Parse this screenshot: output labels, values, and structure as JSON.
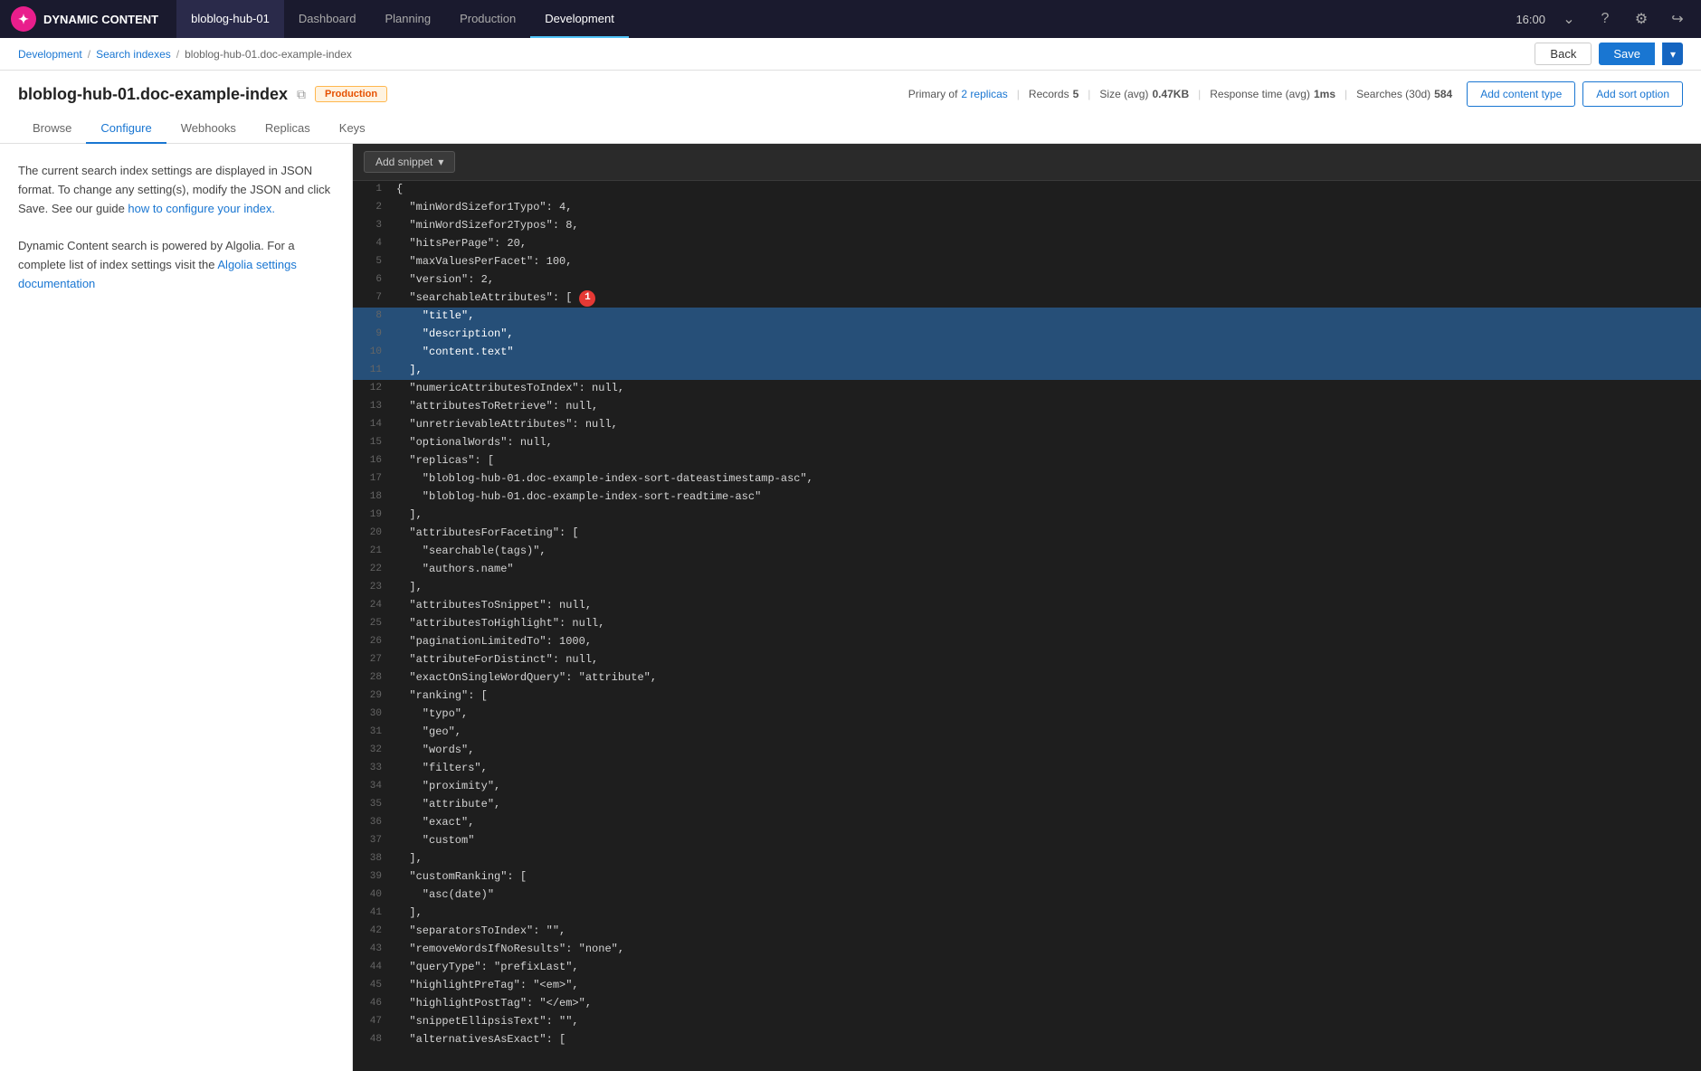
{
  "app": {
    "logo_text": "DYNAMIC CONTENT",
    "logo_icon": "✦"
  },
  "nav": {
    "current_app": "bloblog-hub-01",
    "tabs": [
      {
        "label": "Dashboard",
        "active": false
      },
      {
        "label": "Planning",
        "active": false
      },
      {
        "label": "Production",
        "active": false
      },
      {
        "label": "Development",
        "active": true
      }
    ],
    "time": "16:00"
  },
  "breadcrumb": {
    "items": [
      {
        "label": "Development",
        "href": "#"
      },
      {
        "label": "Search indexes",
        "href": "#"
      },
      {
        "label": "bloblog-hub-01.doc-example-index",
        "href": "#"
      }
    ],
    "back_label": "Back",
    "save_label": "Save"
  },
  "page": {
    "title": "bloblog-hub-01.doc-example-index",
    "env_badge": "Production",
    "meta": {
      "primary_of": "Primary of ",
      "replicas_count": "2 replicas",
      "records_label": "Records",
      "records_value": "5",
      "size_label": "Size (avg)",
      "size_value": "0.47KB",
      "response_label": "Response time (avg)",
      "response_value": "1ms",
      "searches_label": "Searches (30d)",
      "searches_value": "584"
    },
    "tabs": [
      {
        "label": "Browse",
        "active": false
      },
      {
        "label": "Configure",
        "active": true
      },
      {
        "label": "Webhooks",
        "active": false
      },
      {
        "label": "Replicas",
        "active": false
      },
      {
        "label": "Keys",
        "active": false
      }
    ],
    "add_content_type_label": "Add content type",
    "add_sort_option_label": "Add sort option"
  },
  "sidebar": {
    "para1": "The current search index settings are displayed in JSON format. To change any setting(s), modify the JSON and click Save. See our guide ",
    "para1_link_text": "how to configure your index.",
    "para2": "Dynamic Content search is powered by Algolia. For a complete list of index settings visit the ",
    "para2_link_text": "Algolia settings documentation"
  },
  "editor": {
    "snippet_button": "Add snippet",
    "lines": [
      {
        "num": 1,
        "content": "{",
        "selected": false
      },
      {
        "num": 2,
        "content": "  \"minWordSizefor1Typo\": 4,",
        "selected": false
      },
      {
        "num": 3,
        "content": "  \"minWordSizefor2Typos\": 8,",
        "selected": false
      },
      {
        "num": 4,
        "content": "  \"hitsPerPage\": 20,",
        "selected": false
      },
      {
        "num": 5,
        "content": "  \"maxValuesPerFacet\": 100,",
        "selected": false
      },
      {
        "num": 6,
        "content": "  \"version\": 2,",
        "selected": false
      },
      {
        "num": 7,
        "content": "  \"searchableAttributes\": [",
        "selected": false,
        "has_annotation": true
      },
      {
        "num": 8,
        "content": "    \"title\",",
        "selected": true
      },
      {
        "num": 9,
        "content": "    \"description\",",
        "selected": true
      },
      {
        "num": 10,
        "content": "    \"content.text\"",
        "selected": true
      },
      {
        "num": 11,
        "content": "  ],",
        "selected": true
      },
      {
        "num": 12,
        "content": "  \"numericAttributesToIndex\": null,",
        "selected": false
      },
      {
        "num": 13,
        "content": "  \"attributesToRetrieve\": null,",
        "selected": false
      },
      {
        "num": 14,
        "content": "  \"unretrievableAttributes\": null,",
        "selected": false
      },
      {
        "num": 15,
        "content": "  \"optionalWords\": null,",
        "selected": false
      },
      {
        "num": 16,
        "content": "  \"replicas\": [",
        "selected": false
      },
      {
        "num": 17,
        "content": "    \"bloblog-hub-01.doc-example-index-sort-dateastimestamp-asc\",",
        "selected": false
      },
      {
        "num": 18,
        "content": "    \"bloblog-hub-01.doc-example-index-sort-readtime-asc\"",
        "selected": false
      },
      {
        "num": 19,
        "content": "  ],",
        "selected": false
      },
      {
        "num": 20,
        "content": "  \"attributesForFaceting\": [",
        "selected": false
      },
      {
        "num": 21,
        "content": "    \"searchable(tags)\",",
        "selected": false
      },
      {
        "num": 22,
        "content": "    \"authors.name\"",
        "selected": false
      },
      {
        "num": 23,
        "content": "  ],",
        "selected": false
      },
      {
        "num": 24,
        "content": "  \"attributesToSnippet\": null,",
        "selected": false
      },
      {
        "num": 25,
        "content": "  \"attributesToHighlight\": null,",
        "selected": false
      },
      {
        "num": 26,
        "content": "  \"paginationLimitedTo\": 1000,",
        "selected": false
      },
      {
        "num": 27,
        "content": "  \"attributeForDistinct\": null,",
        "selected": false
      },
      {
        "num": 28,
        "content": "  \"exactOnSingleWordQuery\": \"attribute\",",
        "selected": false
      },
      {
        "num": 29,
        "content": "  \"ranking\": [",
        "selected": false
      },
      {
        "num": 30,
        "content": "    \"typo\",",
        "selected": false
      },
      {
        "num": 31,
        "content": "    \"geo\",",
        "selected": false
      },
      {
        "num": 32,
        "content": "    \"words\",",
        "selected": false
      },
      {
        "num": 33,
        "content": "    \"filters\",",
        "selected": false
      },
      {
        "num": 34,
        "content": "    \"proximity\",",
        "selected": false
      },
      {
        "num": 35,
        "content": "    \"attribute\",",
        "selected": false
      },
      {
        "num": 36,
        "content": "    \"exact\",",
        "selected": false
      },
      {
        "num": 37,
        "content": "    \"custom\"",
        "selected": false
      },
      {
        "num": 38,
        "content": "  ],",
        "selected": false
      },
      {
        "num": 39,
        "content": "  \"customRanking\": [",
        "selected": false
      },
      {
        "num": 40,
        "content": "    \"asc(date)\"",
        "selected": false
      },
      {
        "num": 41,
        "content": "  ],",
        "selected": false
      },
      {
        "num": 42,
        "content": "  \"separatorsToIndex\": \"\",",
        "selected": false
      },
      {
        "num": 43,
        "content": "  \"removeWordsIfNoResults\": \"none\",",
        "selected": false
      },
      {
        "num": 44,
        "content": "  \"queryType\": \"prefixLast\",",
        "selected": false
      },
      {
        "num": 45,
        "content": "  \"highlightPreTag\": \"<em>\",",
        "selected": false
      },
      {
        "num": 46,
        "content": "  \"highlightPostTag\": \"</em>\",",
        "selected": false
      },
      {
        "num": 47,
        "content": "  \"snippetEllipsisText\": \"\",",
        "selected": false
      },
      {
        "num": 48,
        "content": "  \"alternativesAsExact\": [",
        "selected": false
      }
    ]
  }
}
